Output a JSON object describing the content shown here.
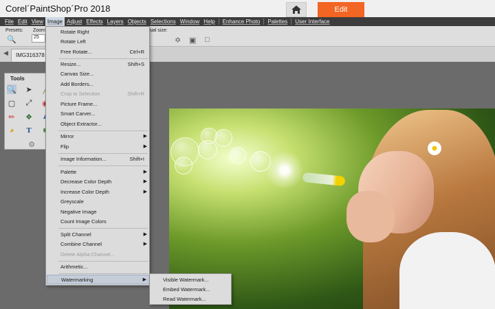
{
  "app": {
    "title": "Corel´PaintShop´Pro 2018",
    "edit_tab": "Edit",
    "home_icon": "home-icon"
  },
  "menubar": {
    "items": [
      "File",
      "Edit",
      "View",
      "Image",
      "Adjust",
      "Effects",
      "Layers",
      "Objects",
      "Selections",
      "Window",
      "Help",
      "Enhance Photo",
      "Palettes",
      "User Interface"
    ],
    "active": "Image"
  },
  "options": {
    "presets_label": "Presets:",
    "zoom_label": "Zoom (",
    "zoom_value": "25",
    "actual_size_label": "ual size:"
  },
  "tabs": {
    "document": "IMG316378"
  },
  "tools": {
    "title": "Tools"
  },
  "image_menu": {
    "items": [
      {
        "label": "Rotate Right",
        "shortcut": "",
        "submenu": false,
        "disabled": false
      },
      {
        "label": "Rotate Left",
        "shortcut": "",
        "submenu": false,
        "disabled": false
      },
      {
        "label": "Free Rotate...",
        "shortcut": "Ctrl+R",
        "submenu": false,
        "disabled": false
      },
      {
        "label": "Resize...",
        "shortcut": "Shift+S",
        "submenu": false,
        "disabled": false
      },
      {
        "label": "Canvas Size...",
        "shortcut": "",
        "submenu": false,
        "disabled": false
      },
      {
        "label": "Add Borders...",
        "shortcut": "",
        "submenu": false,
        "disabled": false
      },
      {
        "label": "Crop to Selection",
        "shortcut": "Shift+R",
        "submenu": false,
        "disabled": true
      },
      {
        "label": "Picture Frame...",
        "shortcut": "",
        "submenu": false,
        "disabled": false
      },
      {
        "label": "Smart Carver...",
        "shortcut": "",
        "submenu": false,
        "disabled": false
      },
      {
        "label": "Object Extractor...",
        "shortcut": "",
        "submenu": false,
        "disabled": false
      },
      {
        "label": "Mirror",
        "shortcut": "",
        "submenu": true,
        "disabled": false
      },
      {
        "label": "Flip",
        "shortcut": "",
        "submenu": true,
        "disabled": false
      },
      {
        "label": "Image Information...",
        "shortcut": "Shift+I",
        "submenu": false,
        "disabled": false
      },
      {
        "label": "Palette",
        "shortcut": "",
        "submenu": true,
        "disabled": false
      },
      {
        "label": "Decrease Color Depth",
        "shortcut": "",
        "submenu": true,
        "disabled": false
      },
      {
        "label": "Increase Color Depth",
        "shortcut": "",
        "submenu": true,
        "disabled": false
      },
      {
        "label": "Greyscale",
        "shortcut": "",
        "submenu": false,
        "disabled": false
      },
      {
        "label": "Negative Image",
        "shortcut": "",
        "submenu": false,
        "disabled": false
      },
      {
        "label": "Count Image Colors",
        "shortcut": "",
        "submenu": false,
        "disabled": false
      },
      {
        "label": "Split Channel",
        "shortcut": "",
        "submenu": true,
        "disabled": false
      },
      {
        "label": "Combine Channel",
        "shortcut": "",
        "submenu": true,
        "disabled": false
      },
      {
        "label": "Delete Alpha Channel...",
        "shortcut": "",
        "submenu": false,
        "disabled": true
      },
      {
        "label": "Arithmetic...",
        "shortcut": "",
        "submenu": false,
        "disabled": false
      },
      {
        "label": "Watermarking",
        "shortcut": "",
        "submenu": true,
        "disabled": false,
        "highlight": true
      }
    ]
  },
  "watermark_submenu": {
    "items": [
      "Visible Watermark...",
      "Embed Watermark...",
      "Read Watermark..."
    ]
  },
  "colors": {
    "accent": "#f26522",
    "menubar": "#3c3c3c",
    "workspace": "#6b6b6b",
    "menu_bg": "#dcdcdc",
    "highlight": "#c5cdd8"
  }
}
